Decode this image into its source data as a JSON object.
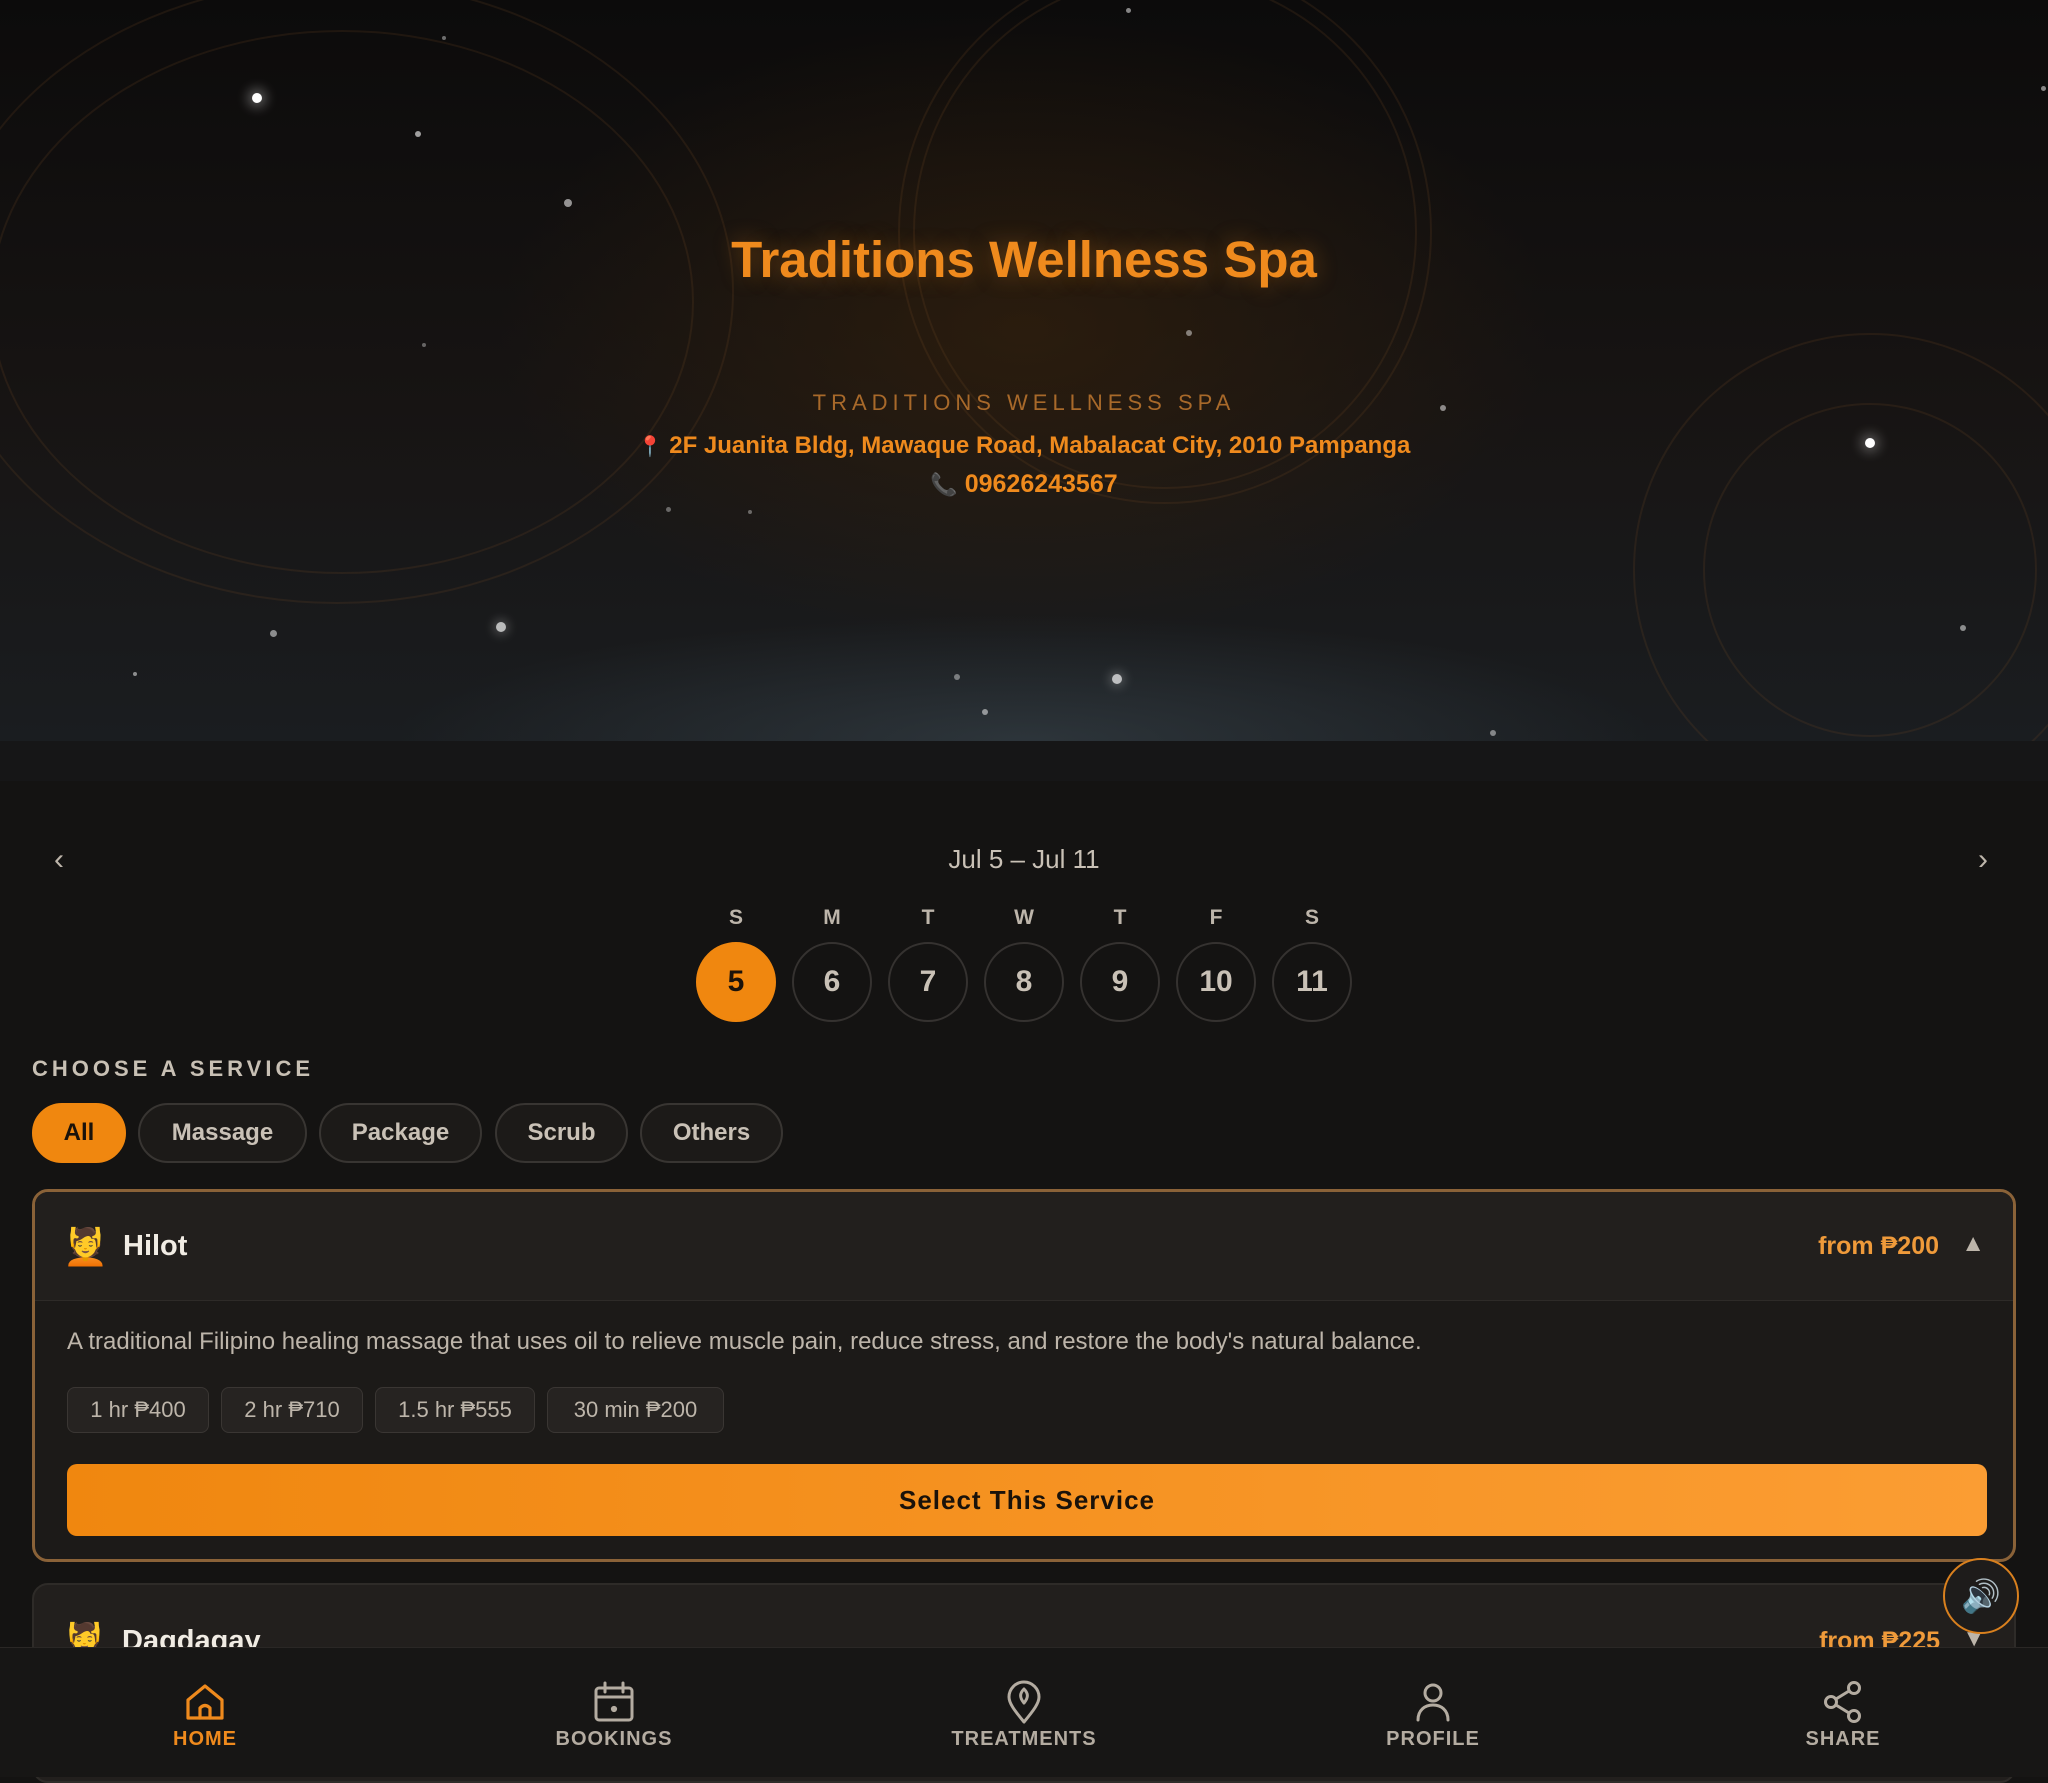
{
  "hero": {
    "title": "Traditions Wellness Spa",
    "subtitle": "TRADITIONS WELLNESS SPA",
    "address_icon": "📍",
    "address": "2F Juanita Bldg, Mawaque Road, Mabalacat City, 2010 Pampanga",
    "phone_icon": "📞",
    "phone": "09626243567"
  },
  "week": {
    "prev": "‹",
    "next": "›",
    "range": "Jul 5 – Jul 11",
    "days": [
      {
        "letter": "S",
        "num": "5"
      },
      {
        "letter": "M",
        "num": "6"
      },
      {
        "letter": "T",
        "num": "7"
      },
      {
        "letter": "W",
        "num": "8"
      },
      {
        "letter": "T",
        "num": "9"
      },
      {
        "letter": "F",
        "num": "10"
      },
      {
        "letter": "S",
        "num": "11"
      }
    ],
    "selected_index": 0
  },
  "services": {
    "heading": "CHOOSE A SERVICE",
    "filters": [
      "All",
      "Massage",
      "Package",
      "Scrub",
      "Others"
    ],
    "active_filter": "All",
    "items": [
      {
        "icon": "💆",
        "name": "Hilot",
        "price": "from ₱200",
        "caret": "▲",
        "description": "A traditional Filipino healing massage that uses oil to relieve muscle pain, reduce stress, and restore the body's natural balance.",
        "options": [
          "1 hr ₱400",
          "2 hr ₱710",
          "1.5 hr ₱555",
          "30 min ₱200"
        ],
        "select_label": "Select This Service"
      },
      {
        "icon": "💆",
        "name": "Dagdagay",
        "price": "from ₱225",
        "caret": "▼"
      }
    ]
  },
  "sound_button": "🔊",
  "bottom_nav": [
    {
      "label": "HOME",
      "icon": "home-icon",
      "active": true
    },
    {
      "label": "BOOKINGS",
      "icon": "calendar-icon",
      "active": false
    },
    {
      "label": "TREATMENTS",
      "icon": "location-pin-icon",
      "active": false
    },
    {
      "label": "PROFILE",
      "icon": "user-icon",
      "active": false
    },
    {
      "label": "SHARE",
      "icon": "share-icon",
      "active": false
    }
  ],
  "colors": {
    "accent": "#f0870f",
    "background": "#141312",
    "card_border": "#8a6238"
  }
}
